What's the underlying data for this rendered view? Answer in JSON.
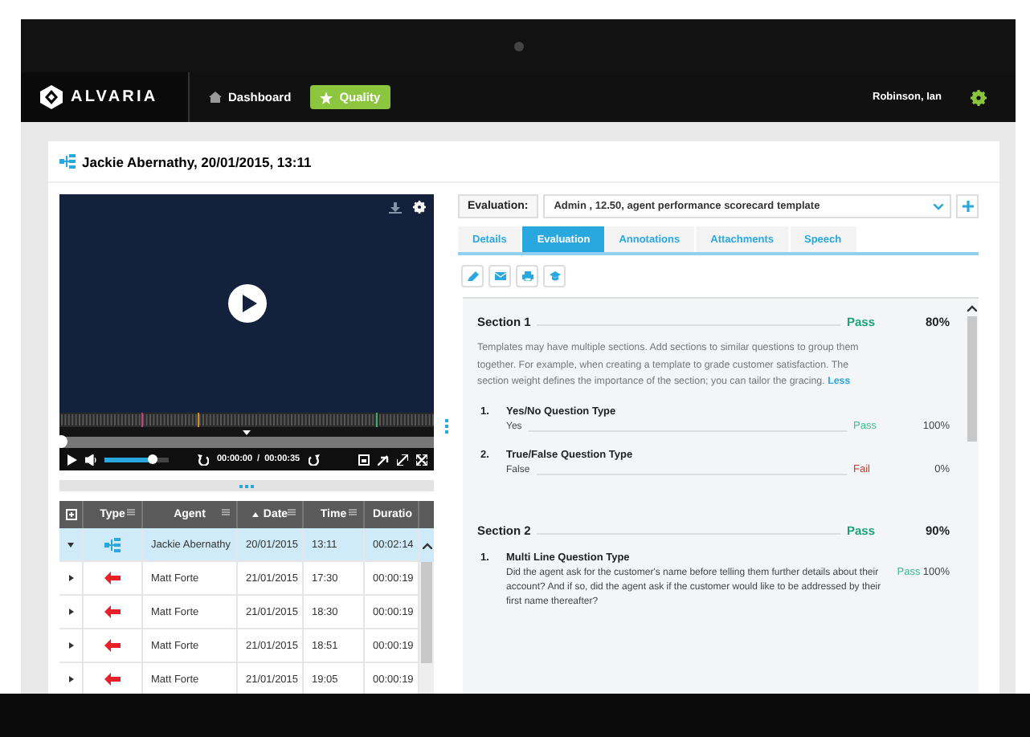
{
  "nav": {
    "logo": "ALVARIA",
    "items": [
      {
        "label": "Dashboard",
        "selected": false
      },
      {
        "label": "Quality",
        "selected": true
      }
    ],
    "user": "Robinson, Ian"
  },
  "record": {
    "title": "Jackie Abernathy, 20/01/2015, 13:11"
  },
  "player": {
    "progress": {
      "level": 0
    },
    "volume": {
      "level": 0.74
    },
    "time_current": "00:00:00",
    "time_separator": "/",
    "time_total": "00:00:35"
  },
  "table": {
    "columns": [
      {
        "label": "Type",
        "sorted": false
      },
      {
        "label": "Agent",
        "sorted": false
      },
      {
        "label": "Date",
        "sorted": true
      },
      {
        "label": "Time",
        "sorted": false
      },
      {
        "label": "Duratio",
        "sorted": false
      }
    ],
    "rows": [
      {
        "kind": "conversation",
        "expanded": true,
        "selected": true,
        "agent": "Jackie Abernathy",
        "date": "20/01/2015",
        "time": "13:11",
        "duration": "00:02:14"
      },
      {
        "kind": "call",
        "expanded": false,
        "selected": false,
        "agent": "Matt Forte",
        "date": "21/01/2015",
        "time": "17:30",
        "duration": "00:00:19"
      },
      {
        "kind": "call",
        "expanded": false,
        "selected": false,
        "agent": "Matt Forte",
        "date": "21/01/2015",
        "time": "18:30",
        "duration": "00:00:19"
      },
      {
        "kind": "call",
        "expanded": false,
        "selected": false,
        "agent": "Matt Forte",
        "date": "21/01/2015",
        "time": "18:51",
        "duration": "00:00:19"
      },
      {
        "kind": "call",
        "expanded": false,
        "selected": false,
        "agent": "Matt Forte",
        "date": "21/01/2015",
        "time": "19:05",
        "duration": "00:00:19"
      }
    ]
  },
  "evaluation": {
    "label": "Evaluation:",
    "template": "Admin , 12.50, agent performance scorecard template",
    "tabs": [
      {
        "label": "Details",
        "selected": false
      },
      {
        "label": "Evaluation",
        "selected": true
      },
      {
        "label": "Annotations",
        "selected": false
      },
      {
        "label": "Attachments",
        "selected": false
      },
      {
        "label": "Speech",
        "selected": false
      }
    ],
    "sections": [
      {
        "title": "Section 1",
        "result": "Pass",
        "color": "#1aa37a",
        "score": "80%",
        "description": "Templates may have multiple sections. Add sections to similar questions to group them together. For example, when creating a template to grade customer satisfaction. The section weight defines the importance of the section; you can tailor the gracing.",
        "link": "Less",
        "questions": [
          {
            "number": "1.",
            "title": "Yes/No Question Type",
            "answer": "Yes",
            "result": "Pass",
            "color": "#3dbf8f",
            "score": "100%"
          },
          {
            "number": "2.",
            "title": "True/False Question Type",
            "answer": "False",
            "result": "Fail",
            "color": "#c0392b",
            "score": "0%"
          }
        ]
      },
      {
        "title": "Section 2",
        "result": "Pass",
        "color": "#1aa37a",
        "score": "90%",
        "questions": [
          {
            "number": "1.",
            "title": "Multi Line Question Type",
            "answer": "Did the agent ask for the customer's name before telling them further details about their account? And if so, did the agent ask if the customer would like to be addressed by their first name thereafter?",
            "result": "Pass",
            "color": "#3dbf8f",
            "score": "100%"
          }
        ]
      }
    ]
  }
}
